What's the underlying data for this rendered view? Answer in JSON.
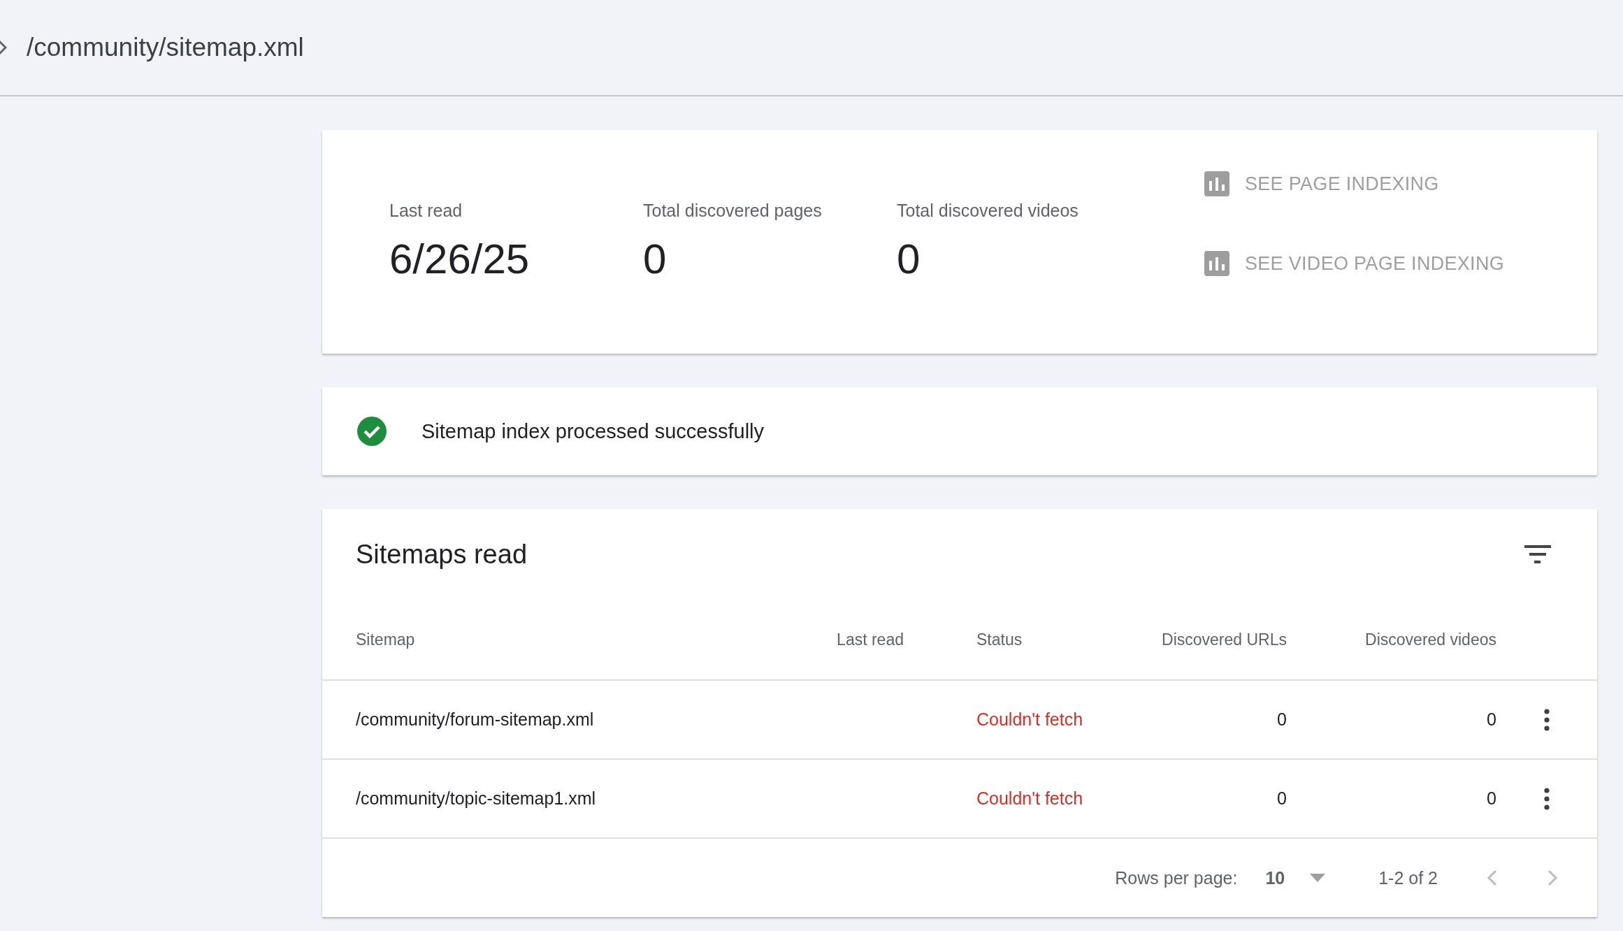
{
  "header": {
    "title": "/community/sitemap.xml"
  },
  "summary": {
    "stats": [
      {
        "label": "Last read",
        "value": "6/26/25"
      },
      {
        "label": "Total discovered pages",
        "value": "0"
      },
      {
        "label": "Total discovered videos",
        "value": "0"
      }
    ],
    "links": [
      {
        "label": "SEE PAGE INDEXING",
        "disabled": true
      },
      {
        "label": "SEE VIDEO PAGE INDEXING",
        "disabled": true
      }
    ]
  },
  "status_card": {
    "kind": "success",
    "message": "Sitemap index processed successfully"
  },
  "table": {
    "title": "Sitemaps read",
    "columns": [
      "Sitemap",
      "Last read",
      "Status",
      "Discovered URLs",
      "Discovered videos"
    ],
    "rows": [
      {
        "sitemap": "/community/forum-sitemap.xml",
        "status": {
          "text": "Couldn't fetch",
          "kind": "error"
        },
        "urls": "0",
        "videos": "0"
      },
      {
        "sitemap": "/community/topic-sitemap1.xml",
        "status": {
          "text": "Couldn't fetch",
          "kind": "error"
        },
        "urls": "0",
        "videos": "0"
      }
    ],
    "footer": {
      "rows_label": "Rows per page:",
      "rows_value": "10",
      "range": "1-2 of 2"
    }
  }
}
